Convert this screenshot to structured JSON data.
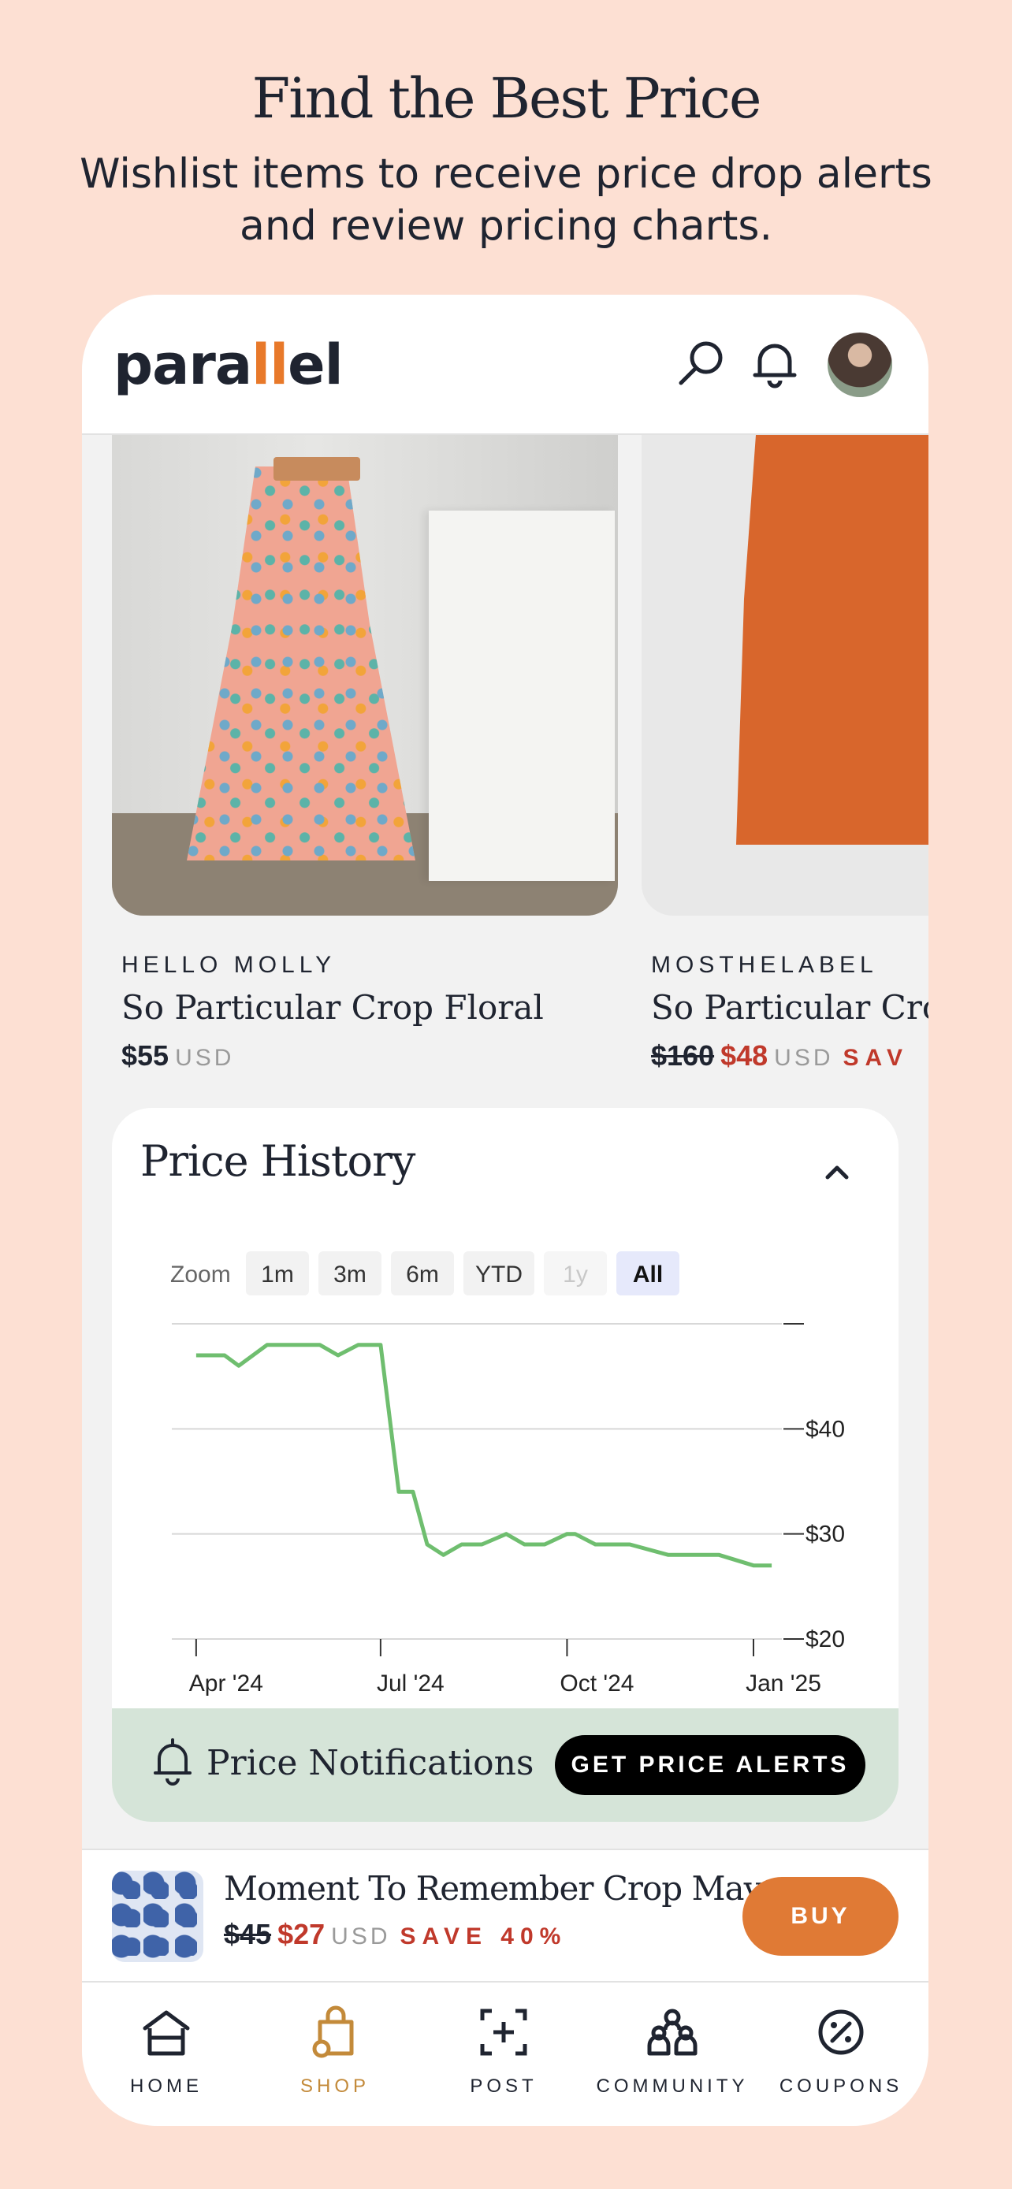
{
  "promo": {
    "title": "Find the Best Price",
    "subtitle": "Wishlist items to receive price drop alerts and review pricing charts."
  },
  "header": {
    "logo_text_pre": "para",
    "logo_text_accent": "ll",
    "logo_text_post": "el",
    "icons": [
      "search-icon",
      "bell-icon",
      "avatar"
    ]
  },
  "products": [
    {
      "brand": "HELLO MOLLY",
      "name": "So Particular Crop Floral",
      "price": "$55",
      "currency": "USD"
    },
    {
      "brand": "MOSTHELABEL",
      "name": "So Particular Crop",
      "original_price": "$160",
      "sale_price": "$48",
      "currency": "USD",
      "save": "SAV"
    }
  ],
  "price_history": {
    "title": "Price History",
    "zoom_label": "Zoom",
    "zoom_options": [
      "1m",
      "3m",
      "6m",
      "YTD",
      "1y",
      "All"
    ],
    "zoom_selected": "All",
    "zoom_disabled": [
      "1y"
    ]
  },
  "chart_data": {
    "type": "line",
    "x": [
      "2024-04-01",
      "2024-04-15",
      "2024-04-22",
      "2024-04-29",
      "2024-05-06",
      "2024-05-15",
      "2024-06-01",
      "2024-06-10",
      "2024-06-20",
      "2024-07-01",
      "2024-07-10",
      "2024-07-17",
      "2024-07-24",
      "2024-08-01",
      "2024-08-10",
      "2024-08-20",
      "2024-09-01",
      "2024-09-10",
      "2024-09-20",
      "2024-10-01",
      "2024-10-05",
      "2024-10-15",
      "2024-11-01",
      "2024-11-20",
      "2024-12-01",
      "2024-12-15",
      "2025-01-01",
      "2025-01-10"
    ],
    "y": [
      47,
      47,
      46,
      47,
      48,
      48,
      48,
      47,
      48,
      48,
      34,
      34,
      29,
      28,
      29,
      29,
      30,
      29,
      29,
      30,
      30,
      29,
      29,
      28,
      28,
      28,
      27,
      27
    ],
    "x_ticks": [
      "Apr '24",
      "Jul '24",
      "Oct '24",
      "Jan '25"
    ],
    "y_ticks": [
      "$20",
      "$30",
      "$40"
    ],
    "ylim": [
      20,
      50
    ],
    "grid": true,
    "line_color": "#6fbe6f"
  },
  "notifications": {
    "label": "Price Notifications",
    "button": "GET PRICE ALERTS"
  },
  "buybar": {
    "name": "Moment To Remember Crop May...",
    "original_price": "$45",
    "sale_price": "$27",
    "currency": "USD",
    "save": "SAVE 40%",
    "button": "BUY"
  },
  "nav": [
    {
      "label": "HOME",
      "icon": "home-icon"
    },
    {
      "label": "SHOP",
      "icon": "shop-icon",
      "active": true
    },
    {
      "label": "POST",
      "icon": "post-icon"
    },
    {
      "label": "COMMUNITY",
      "icon": "community-icon"
    },
    {
      "label": "COUPONS",
      "icon": "coupons-icon"
    }
  ],
  "colors": {
    "accent": "#e8792a",
    "sale": "#c0392b",
    "chart_line": "#6fbe6f",
    "notif_bg": "#d5e4d8",
    "buy": "#e07a35"
  }
}
